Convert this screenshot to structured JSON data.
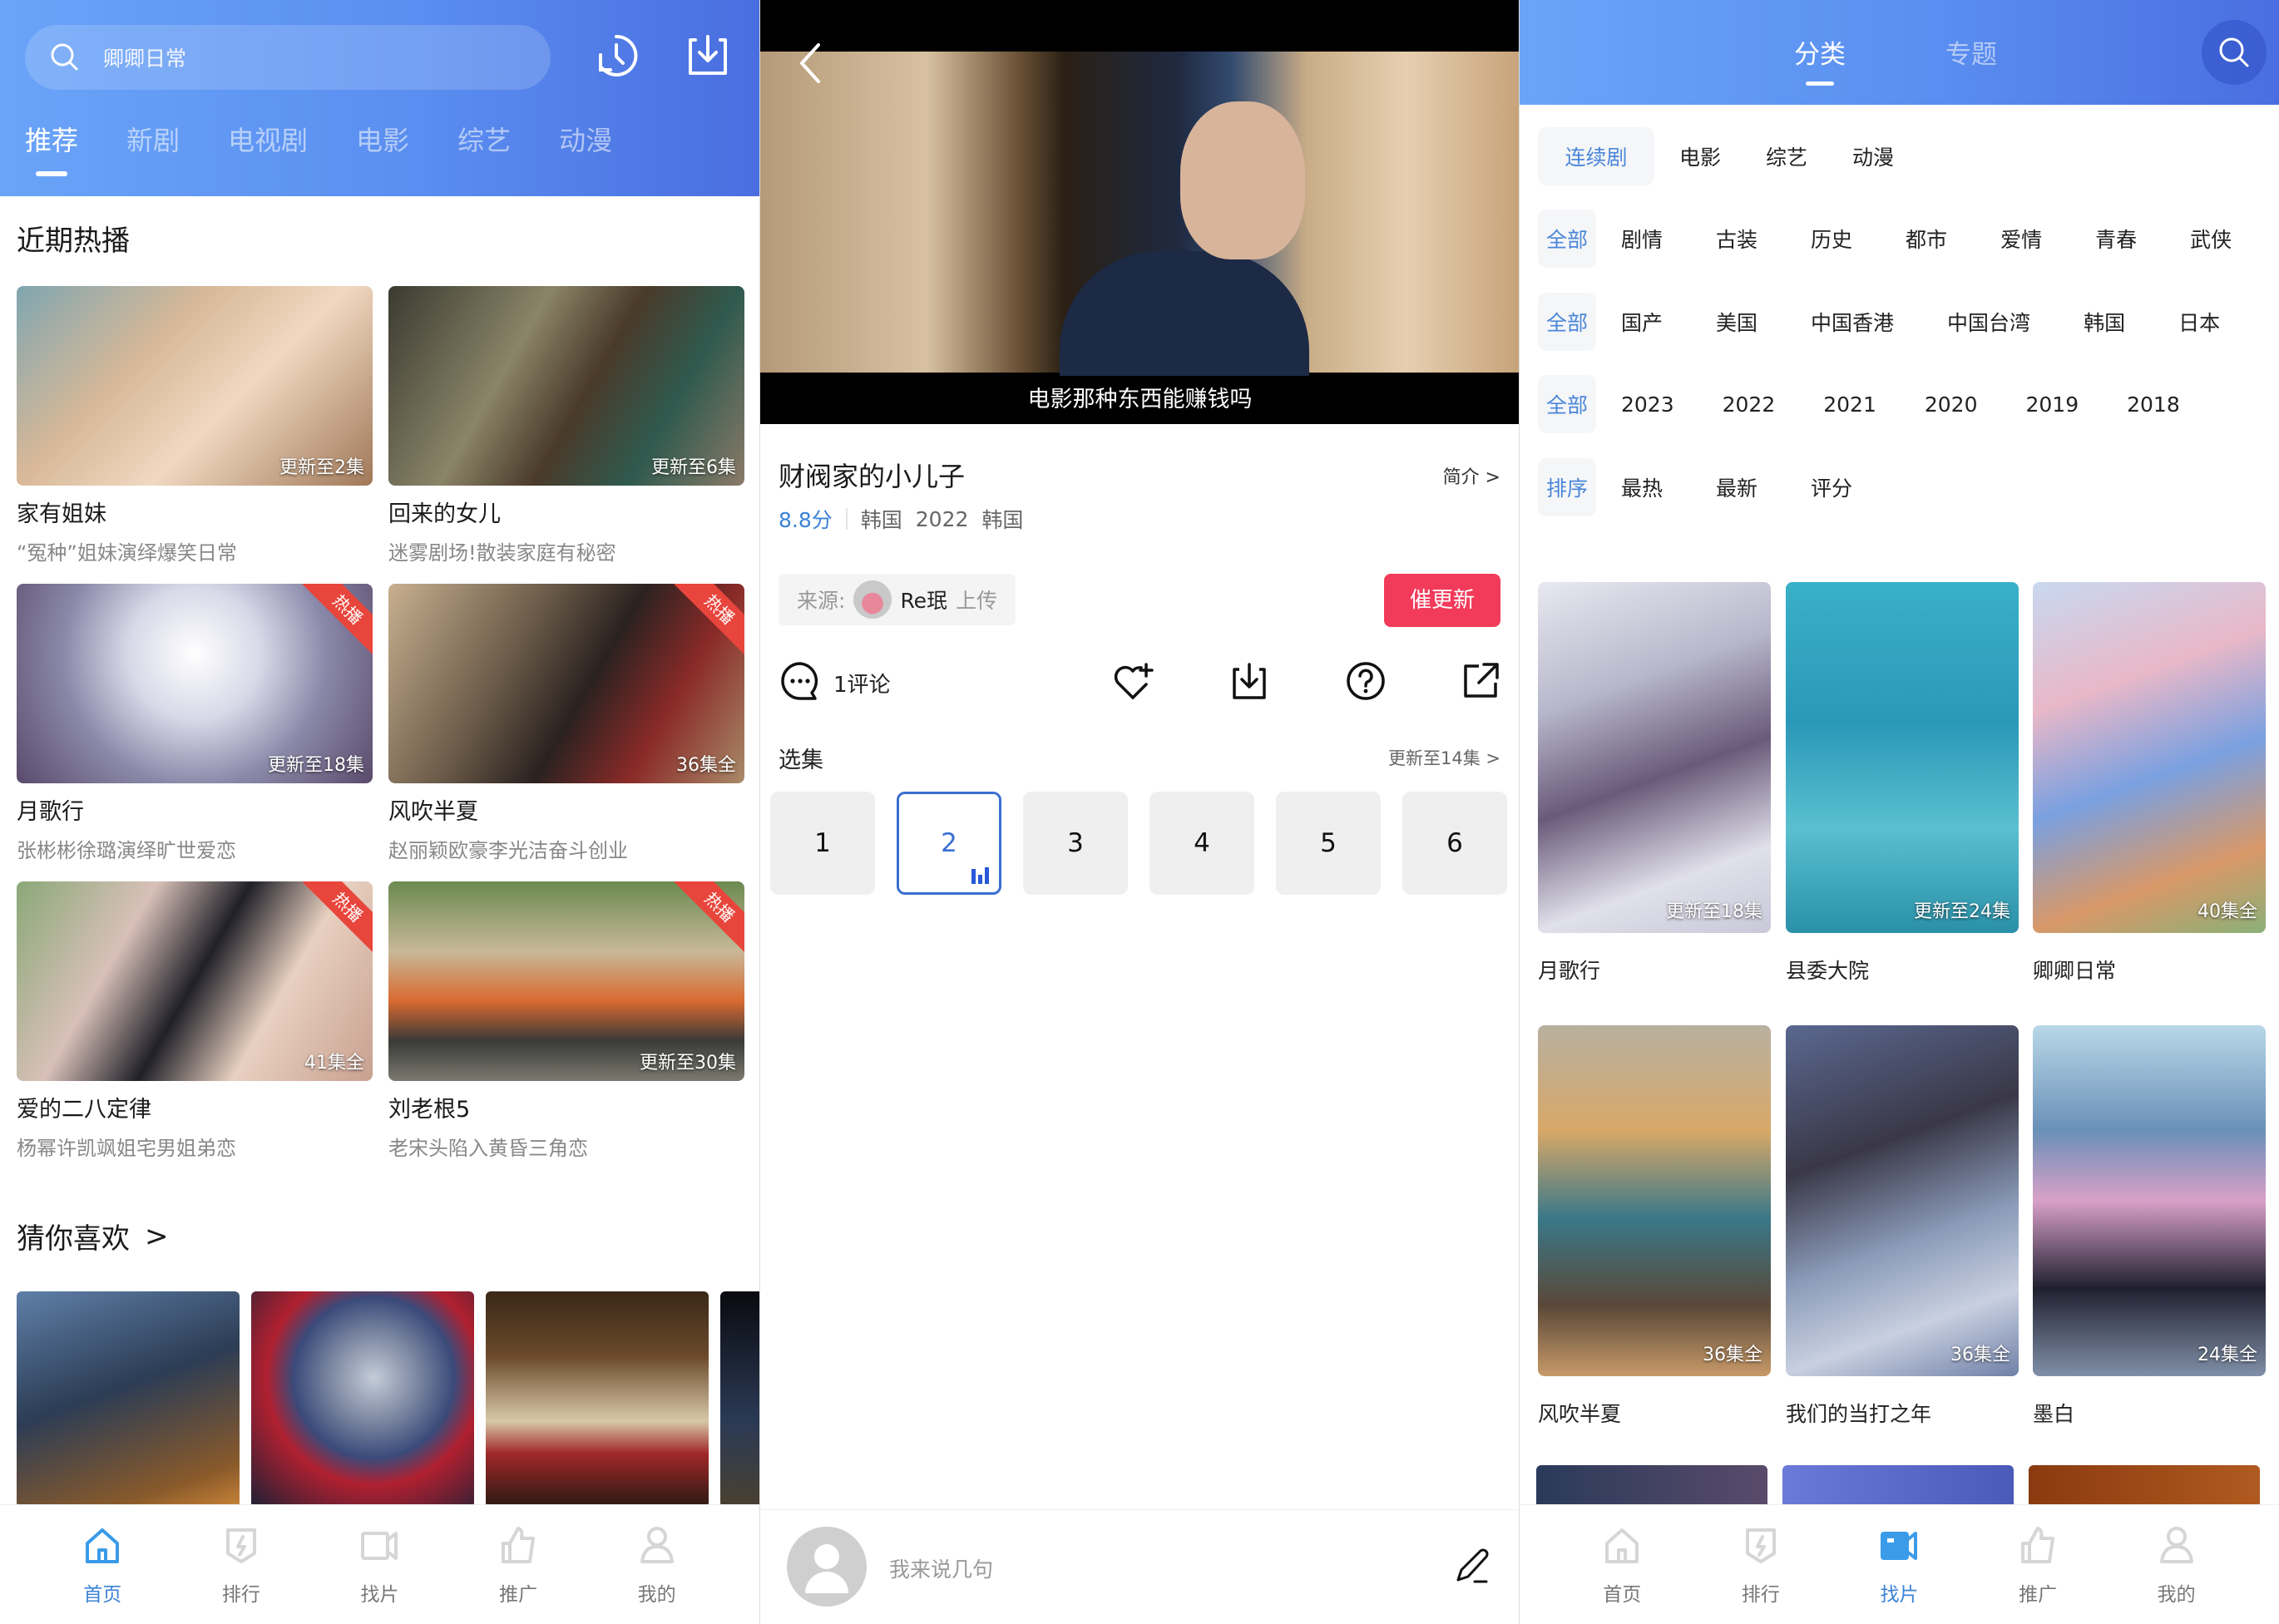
{
  "colors": {
    "accent_blue": "#3b82d6",
    "header_gradient_start": "#6aa4f8",
    "header_gradient_end": "#4a6ee0",
    "urge_red": "#f23b5a",
    "hot_red": "#e8453c"
  },
  "home": {
    "search_placeholder": "卿卿日常",
    "icons": [
      "search-icon",
      "history-icon",
      "download-icon"
    ],
    "tabs": [
      {
        "label": "推荐",
        "active": true
      },
      {
        "label": "新剧",
        "active": false
      },
      {
        "label": "电视剧",
        "active": false
      },
      {
        "label": "电影",
        "active": false
      },
      {
        "label": "综艺",
        "active": false
      },
      {
        "label": "动漫",
        "active": false
      }
    ],
    "section_hot": "近期热播",
    "hot_items": [
      {
        "title": "家有姐妹",
        "subtitle": "“冤种”姐妹演绎爆笑日常",
        "episodes": "更新至2集",
        "hot": false
      },
      {
        "title": "回来的女儿",
        "subtitle": "迷雾剧场!散装家庭有秘密",
        "episodes": "更新至6集",
        "hot": false
      },
      {
        "title": "月歌行",
        "subtitle": "张彬彬徐璐演绎旷世爱恋",
        "episodes": "更新至18集",
        "hot": true
      },
      {
        "title": "风吹半夏",
        "subtitle": "赵丽颖欧豪李光洁奋斗创业",
        "episodes": "36集全",
        "hot": true
      },
      {
        "title": "爱的二八定律",
        "subtitle": "杨幂许凯飒姐宅男姐弟恋",
        "episodes": "41集全",
        "hot": true
      },
      {
        "title": "刘老根5",
        "subtitle": "老宋头陷入黄昏三角恋",
        "episodes": "更新至30集",
        "hot": true
      }
    ],
    "hot_badge": "热播",
    "section_like": "猜你喜欢",
    "like_chevron": ">"
  },
  "nav": [
    {
      "label": "首页",
      "icon": "home-icon"
    },
    {
      "label": "排行",
      "icon": "ranking-icon"
    },
    {
      "label": "找片",
      "icon": "video-camera-icon"
    },
    {
      "label": "推广",
      "icon": "thumbs-up-icon"
    },
    {
      "label": "我的",
      "icon": "user-icon"
    }
  ],
  "nav_active": {
    "home_panel": 0,
    "category_panel": 2
  },
  "detail": {
    "subtitle_caption": "电影那种东西能赚钱吗",
    "title": "财阀家的小儿子",
    "intro_label": "简介 >",
    "score": "8.8分",
    "meta": [
      "韩国",
      "2022",
      "韩国"
    ],
    "source_label": "来源:",
    "uploader": "Re珉",
    "upload_label": "上传",
    "urge_button": "催更新",
    "comment_count_label": "1评论",
    "action_icons": [
      "comment-icon",
      "favorite-add-icon",
      "download-icon",
      "help-icon",
      "share-icon"
    ],
    "episodes_label": "选集",
    "episodes_more": "更新至14集 >",
    "episodes": [
      "1",
      "2",
      "3",
      "4",
      "5",
      "6"
    ],
    "active_episode": "2",
    "comment_placeholder": "我来说几句"
  },
  "category": {
    "tabs": [
      {
        "label": "分类",
        "active": true
      },
      {
        "label": "专题",
        "active": false
      }
    ],
    "filters": [
      {
        "first": "连续剧",
        "options": [
          "电影",
          "综艺",
          "动漫"
        ]
      },
      {
        "first": "全部",
        "options": [
          "剧情",
          "古装",
          "历史",
          "都市",
          "爱情",
          "青春",
          "武侠"
        ]
      },
      {
        "first": "全部",
        "options": [
          "国产",
          "美国",
          "中国香港",
          "中国台湾",
          "韩国",
          "日本"
        ]
      },
      {
        "first": "全部",
        "options": [
          "2023",
          "2022",
          "2021",
          "2020",
          "2019",
          "2018"
        ]
      },
      {
        "first": "排序",
        "options": [
          "最热",
          "最新",
          "评分"
        ]
      }
    ],
    "posters": [
      {
        "title": "月歌行",
        "episodes": "更新至18集"
      },
      {
        "title": "县委大院",
        "episodes": "更新至24集"
      },
      {
        "title": "卿卿日常",
        "episodes": "40集全"
      },
      {
        "title": "风吹半夏",
        "episodes": "36集全"
      },
      {
        "title": "我们的当打之年",
        "episodes": "36集全"
      },
      {
        "title": "墨白",
        "episodes": "24集全"
      }
    ]
  }
}
